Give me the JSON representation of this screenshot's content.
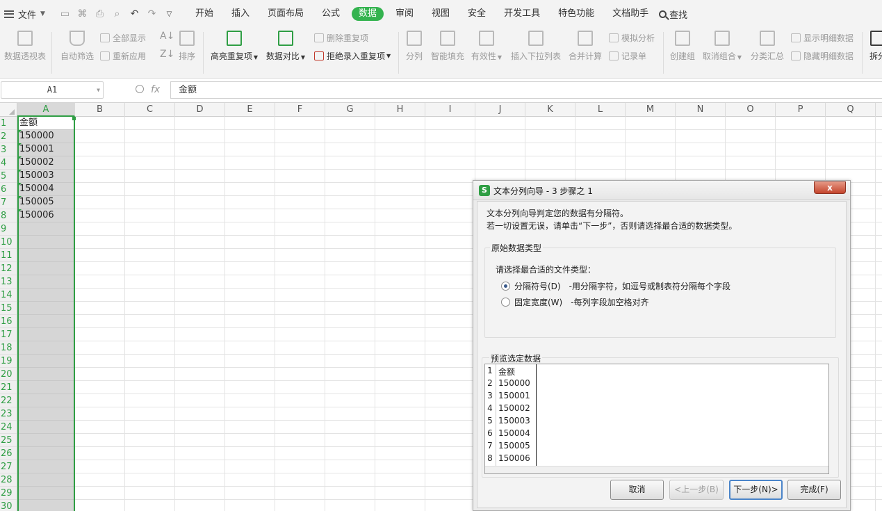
{
  "menubar": {
    "file": "文件",
    "tabs": [
      {
        "label": "开始",
        "active": false
      },
      {
        "label": "插入",
        "active": false
      },
      {
        "label": "页面布局",
        "active": false
      },
      {
        "label": "公式",
        "active": false
      },
      {
        "label": "数据",
        "active": true
      },
      {
        "label": "审阅",
        "active": false
      },
      {
        "label": "视图",
        "active": false
      },
      {
        "label": "安全",
        "active": false
      },
      {
        "label": "开发工具",
        "active": false
      },
      {
        "label": "特色功能",
        "active": false
      },
      {
        "label": "文档助手",
        "active": false
      }
    ],
    "search": "查找"
  },
  "ribbon": {
    "pivot": "数据透视表",
    "autofilter": "自动筛选",
    "show_all": "全部显示",
    "reapply": "重新应用",
    "sort": "排序",
    "highlight_dup": "高亮重复项",
    "compare": "数据对比",
    "remove_dup": "删除重复项",
    "reject_dup": "拒绝录入重复项",
    "split": "分列",
    "flash_fill": "智能填充",
    "validity": "有效性",
    "insert_dropdown": "插入下拉列表",
    "consolidate": "合并计算",
    "what_if": "模拟分析",
    "record": "记录单",
    "group": "创建组",
    "ungroup": "取消组合",
    "subtotal": "分类汇总",
    "show_detail": "显示明细数据",
    "hide_detail": "隐藏明细数据",
    "split_table": "拆分"
  },
  "formula_bar": {
    "name_box": "A1",
    "fx": "fx",
    "content": "金额"
  },
  "sheet": {
    "columns": [
      "A",
      "B",
      "C",
      "D",
      "E",
      "F",
      "G",
      "H",
      "I",
      "J",
      "K",
      "L",
      "M",
      "N",
      "O",
      "P",
      "Q"
    ],
    "rows": [
      "1",
      "2",
      "3",
      "4",
      "5",
      "6",
      "7",
      "8",
      "9",
      "10",
      "11",
      "12",
      "13",
      "14",
      "15",
      "16",
      "17",
      "18",
      "19",
      "20",
      "21",
      "22",
      "23",
      "24",
      "25",
      "26",
      "27",
      "28",
      "29",
      "30"
    ],
    "col_a": [
      "金额",
      "150000",
      "150001",
      "150002",
      "150003",
      "150004",
      "150005",
      "150006"
    ]
  },
  "dialog": {
    "title": "文本分列向导 - 3 步骤之 1",
    "close": "x",
    "line1": "文本分列向导判定您的数据有分隔符。",
    "line2": "若一切设置无误，请单击“下一步”，否则请选择最合适的数据类型。",
    "group_title": "原始数据类型",
    "prompt": "请选择最合适的文件类型：",
    "opt_delimited": "分隔符号(D)",
    "opt_delimited_desc": "-用分隔字符，如逗号或制表符分隔每个字段",
    "opt_fixed": "固定宽度(W)",
    "opt_fixed_desc": "-每列字段加空格对齐",
    "preview_title": "预览选定数据",
    "preview": [
      {
        "n": "1",
        "v": "金额"
      },
      {
        "n": "2",
        "v": "150000"
      },
      {
        "n": "3",
        "v": "150001"
      },
      {
        "n": "4",
        "v": "150002"
      },
      {
        "n": "5",
        "v": "150003"
      },
      {
        "n": "6",
        "v": "150004"
      },
      {
        "n": "7",
        "v": "150005"
      },
      {
        "n": "8",
        "v": "150006"
      }
    ],
    "btn_cancel": "取消",
    "btn_prev": "<上一步(B)",
    "btn_next": "下一步(N)>",
    "btn_finish": "完成(F)"
  },
  "colors": {
    "accent": "#34b34f",
    "close": "#c4452d"
  }
}
